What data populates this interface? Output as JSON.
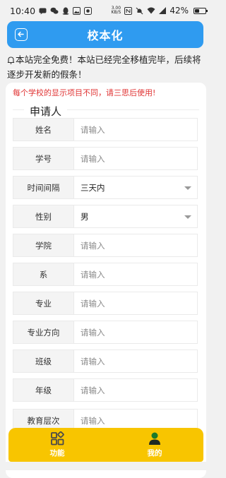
{
  "status_bar": {
    "time": "10:40",
    "net_speed_value": "3.00",
    "net_speed_unit": "KB/S",
    "battery_text": "42%",
    "battery_level": 0.42
  },
  "header": {
    "title": "校本化"
  },
  "notice": {
    "text": "本站完全免费！本站已经完全移植完毕，后续将逐步开发新的假条！"
  },
  "form": {
    "warning": "每个学校的显示项目不同，请三思后使用!",
    "section_title": "申请人",
    "rows": [
      {
        "label": "姓名",
        "placeholder": "请输入"
      },
      {
        "label": "学号",
        "placeholder": "请输入"
      },
      {
        "label": "时间间隔",
        "value": "三天内"
      },
      {
        "label": "性别",
        "value": "男"
      },
      {
        "label": "学院",
        "placeholder": "请输入"
      },
      {
        "label": "系",
        "placeholder": "请输入"
      },
      {
        "label": "专业",
        "placeholder": "请输入"
      },
      {
        "label": "专业方向",
        "placeholder": "请输入"
      },
      {
        "label": "班级",
        "placeholder": "请输入"
      },
      {
        "label": "年级",
        "placeholder": "请输入"
      },
      {
        "label": "教育层次",
        "placeholder": "请输入"
      }
    ]
  },
  "bottom_nav": {
    "tabs": [
      {
        "label": "功能",
        "icon": "grid-icon"
      },
      {
        "label": "我的",
        "icon": "user-icon"
      }
    ]
  },
  "colors": {
    "header_bg": "#2f9bf0",
    "bottom_nav_bg": "#f8c500",
    "warning": "#e03434",
    "user_icon": "#1b7a2a"
  }
}
